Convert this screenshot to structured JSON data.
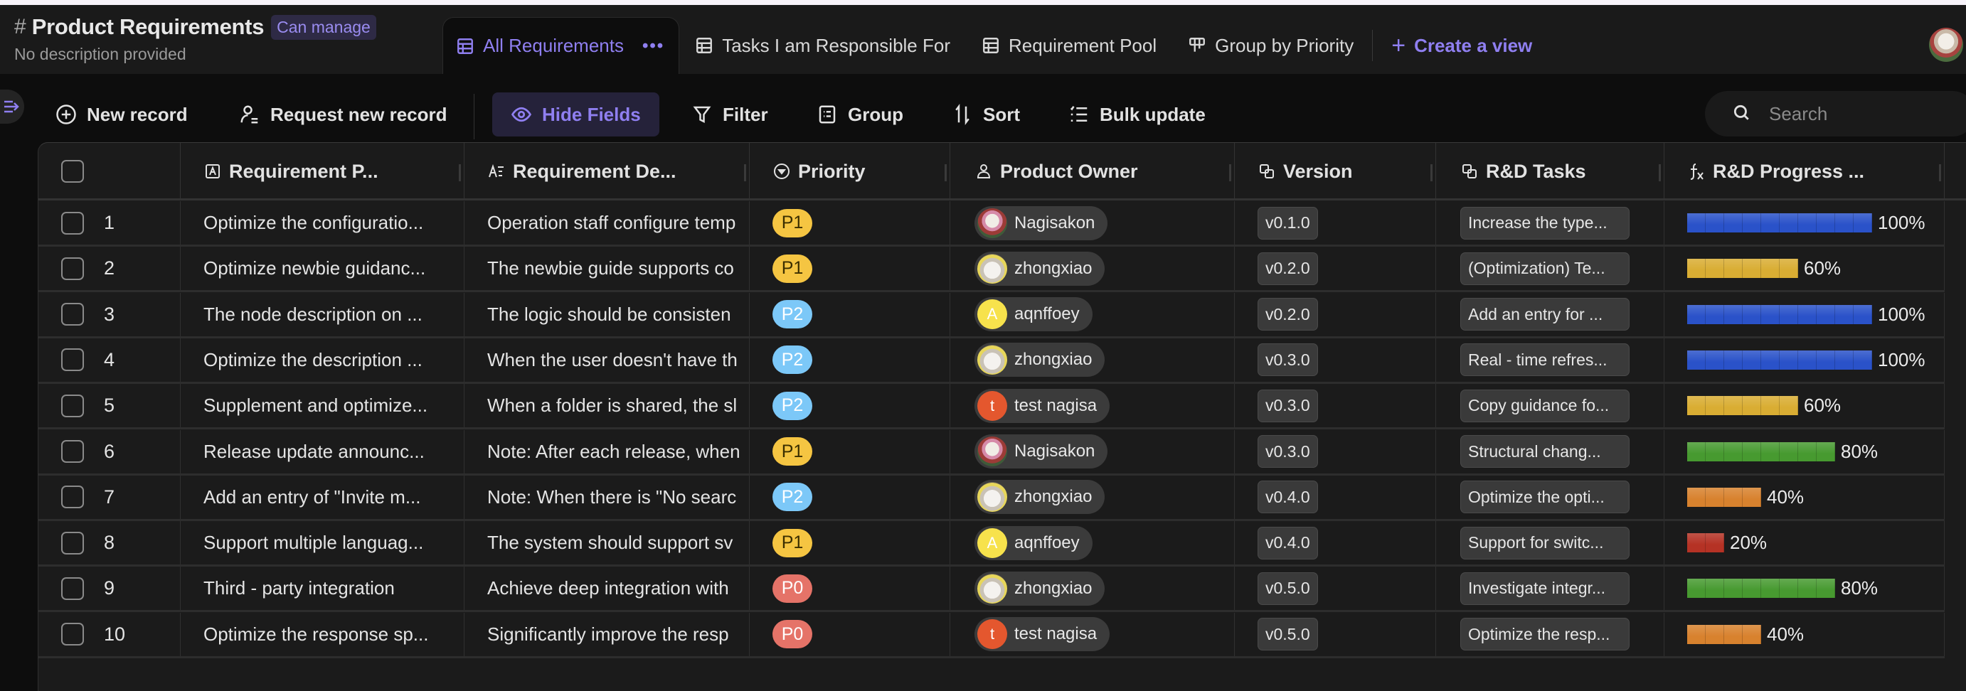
{
  "header": {
    "title": "Product Requirements",
    "permission_badge": "Can manage",
    "description": "No description provided"
  },
  "tabs": [
    {
      "label": "All Requirements",
      "icon": "grid-icon",
      "active": true
    },
    {
      "label": "Tasks I am Responsible For",
      "icon": "grid-icon",
      "active": false
    },
    {
      "label": "Requirement Pool",
      "icon": "grid-icon",
      "active": false
    },
    {
      "label": "Group by Priority",
      "icon": "kanban-icon",
      "active": false
    }
  ],
  "create_view_label": "Create a view",
  "toolbar": {
    "new_record": "New record",
    "request_new_record": "Request new record",
    "hide_fields": "Hide Fields",
    "filter": "Filter",
    "group": "Group",
    "sort": "Sort",
    "bulk_update": "Bulk update",
    "search_placeholder": "Search"
  },
  "columns": [
    {
      "label": "Requirement P...",
      "icon": "text-field-icon"
    },
    {
      "label": "Requirement De...",
      "icon": "long-text-icon"
    },
    {
      "label": "Priority",
      "icon": "select-icon"
    },
    {
      "label": "Product Owner",
      "icon": "person-icon"
    },
    {
      "label": "Version",
      "icon": "link-icon"
    },
    {
      "label": "R&D Tasks",
      "icon": "link-icon"
    },
    {
      "label": "R&D Progress ...",
      "icon": "formula-icon"
    }
  ],
  "priority_colors": {
    "P0": {
      "bg": "#e57368",
      "fg": "#ffffff"
    },
    "P1": {
      "bg": "#f5c542",
      "fg": "#3a2e00"
    },
    "P2": {
      "bg": "#7cc8f8",
      "fg": "#ffffff"
    }
  },
  "progress_colors": {
    "100": "#2a52c9",
    "80": "#479a30",
    "60": "#d9ad33",
    "40": "#d8822e",
    "20": "#b53225"
  },
  "owners": {
    "Nagisakon": {
      "avatar": "photo-nagi",
      "initial": ""
    },
    "zhongxiao": {
      "avatar": "photo-cat",
      "initial": ""
    },
    "aqnffoey": {
      "avatar": "initial",
      "initial": "A",
      "color": "#f7e24c"
    },
    "test nagisa": {
      "avatar": "initial",
      "initial": "t",
      "color": "#e4572e"
    }
  },
  "rows": [
    {
      "num": "1",
      "title": "Optimize the configuratio...",
      "desc": "Operation staff configure temp",
      "priority": "P1",
      "owner": "Nagisakon",
      "version": "v0.1.0",
      "task": "Increase the type...",
      "progress": 100
    },
    {
      "num": "2",
      "title": "Optimize newbie guidanc...",
      "desc": "The newbie guide supports co",
      "priority": "P1",
      "owner": "zhongxiao",
      "version": "v0.2.0",
      "task": "(Optimization) Te...",
      "progress": 60
    },
    {
      "num": "3",
      "title": "The node description on ...",
      "desc": "The logic should be consisten",
      "priority": "P2",
      "owner": "aqnffoey",
      "version": "v0.2.0",
      "task": "Add an entry for ...",
      "progress": 100
    },
    {
      "num": "4",
      "title": "Optimize the description ...",
      "desc": "When the user doesn't have th",
      "priority": "P2",
      "owner": "zhongxiao",
      "version": "v0.3.0",
      "task": "Real - time refres...",
      "progress": 100
    },
    {
      "num": "5",
      "title": "Supplement and optimize...",
      "desc": "When a folder is shared, the sl",
      "priority": "P2",
      "owner": "test nagisa",
      "version": "v0.3.0",
      "task": "Copy guidance fo...",
      "progress": 60
    },
    {
      "num": "6",
      "title": "Release update announc...",
      "desc": "Note: After each release, when",
      "priority": "P1",
      "owner": "Nagisakon",
      "version": "v0.3.0",
      "task": "Structural chang...",
      "progress": 80
    },
    {
      "num": "7",
      "title": "Add an entry of \"Invite m...",
      "desc": "Note: When there is \"No searc",
      "priority": "P2",
      "owner": "zhongxiao",
      "version": "v0.4.0",
      "task": "Optimize the opti...",
      "progress": 40
    },
    {
      "num": "8",
      "title": "Support multiple languag...",
      "desc": "The system should support sv",
      "priority": "P1",
      "owner": "aqnffoey",
      "version": "v0.4.0",
      "task": "Support for switc...",
      "progress": 20
    },
    {
      "num": "9",
      "title": "Third - party integration",
      "desc": "Achieve deep integration with",
      "priority": "P0",
      "owner": "zhongxiao",
      "version": "v0.5.0",
      "task": "Investigate integr...",
      "progress": 80
    },
    {
      "num": "10",
      "title": "Optimize the response sp...",
      "desc": "Significantly improve the resp",
      "priority": "P0",
      "owner": "test nagisa",
      "version": "v0.5.0",
      "task": "Optimize the resp...",
      "progress": 40
    }
  ]
}
